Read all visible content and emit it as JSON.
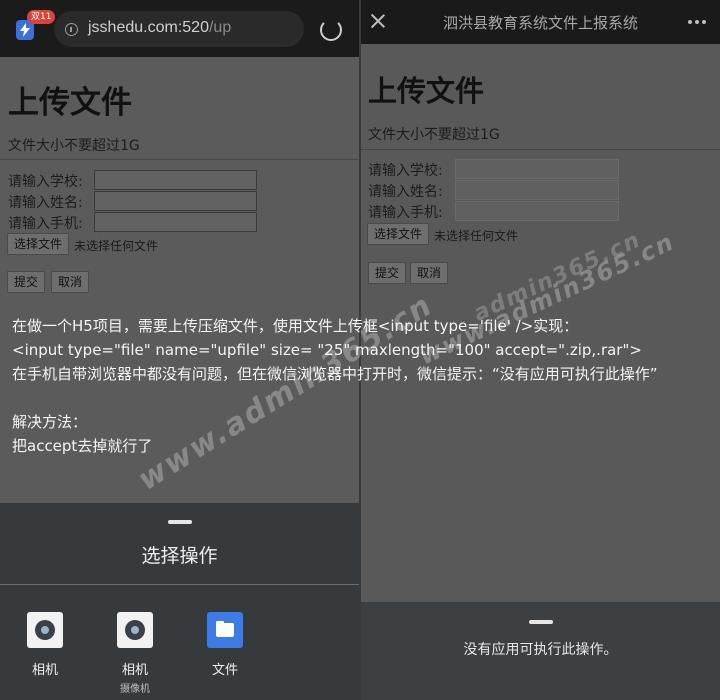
{
  "left": {
    "browser": {
      "badge": "双11",
      "url_main": "jsshedu.com:520",
      "url_dim": "/up",
      "info_icon": "info-icon",
      "reload_icon": "reload-icon"
    },
    "page": {
      "heading": "上传文件",
      "hint": "文件大小不要超过1G",
      "school_label": "请输入学校:",
      "name_label": "请输入姓名:",
      "phone_label": "请输入手机:",
      "choose_file": "选择文件",
      "no_file": "未选择任何文件",
      "submit": "提交",
      "cancel": "取消"
    },
    "sheet": {
      "title": "选择操作",
      "options": [
        {
          "label": "相机",
          "sub": "",
          "icon": "camera-icon"
        },
        {
          "label": "相机",
          "sub": "摄像机",
          "icon": "camera-icon"
        },
        {
          "label": "文件",
          "sub": "",
          "icon": "folder-icon"
        }
      ]
    }
  },
  "right": {
    "title_bar": {
      "title": "泗洪县教育系统文件上报系统",
      "close_icon": "close-icon",
      "more_icon": "more-icon"
    },
    "page": {
      "heading": "上传文件",
      "hint": "文件大小不要超过1G",
      "school_label": "请输入学校:",
      "name_label": "请输入姓名:",
      "phone_label": "请输入手机:",
      "choose_file": "选择文件",
      "no_file": "未选择任何文件",
      "submit": "提交",
      "cancel": "取消"
    },
    "toast": "没有应用可执行此操作。"
  },
  "article": {
    "line1": "在做一个H5项目，需要上传压缩文件，使用文件上传框<input type='file' />实现：",
    "line2": "<input type=\"file\" name=\"upfile\" size= \"25\" maxlength=\"100\" accept=\".zip,.rar\">",
    "line3": "在手机自带浏览器中都没有问题，但在微信浏览器中打开时，微信提示：“没有应用可执行此操作”",
    "line4": "解决方法：",
    "line5": "把accept去掉就行了"
  },
  "watermarks": [
    "www.admin365.cn",
    "www.admin365.cn",
    "admin365.cn"
  ]
}
